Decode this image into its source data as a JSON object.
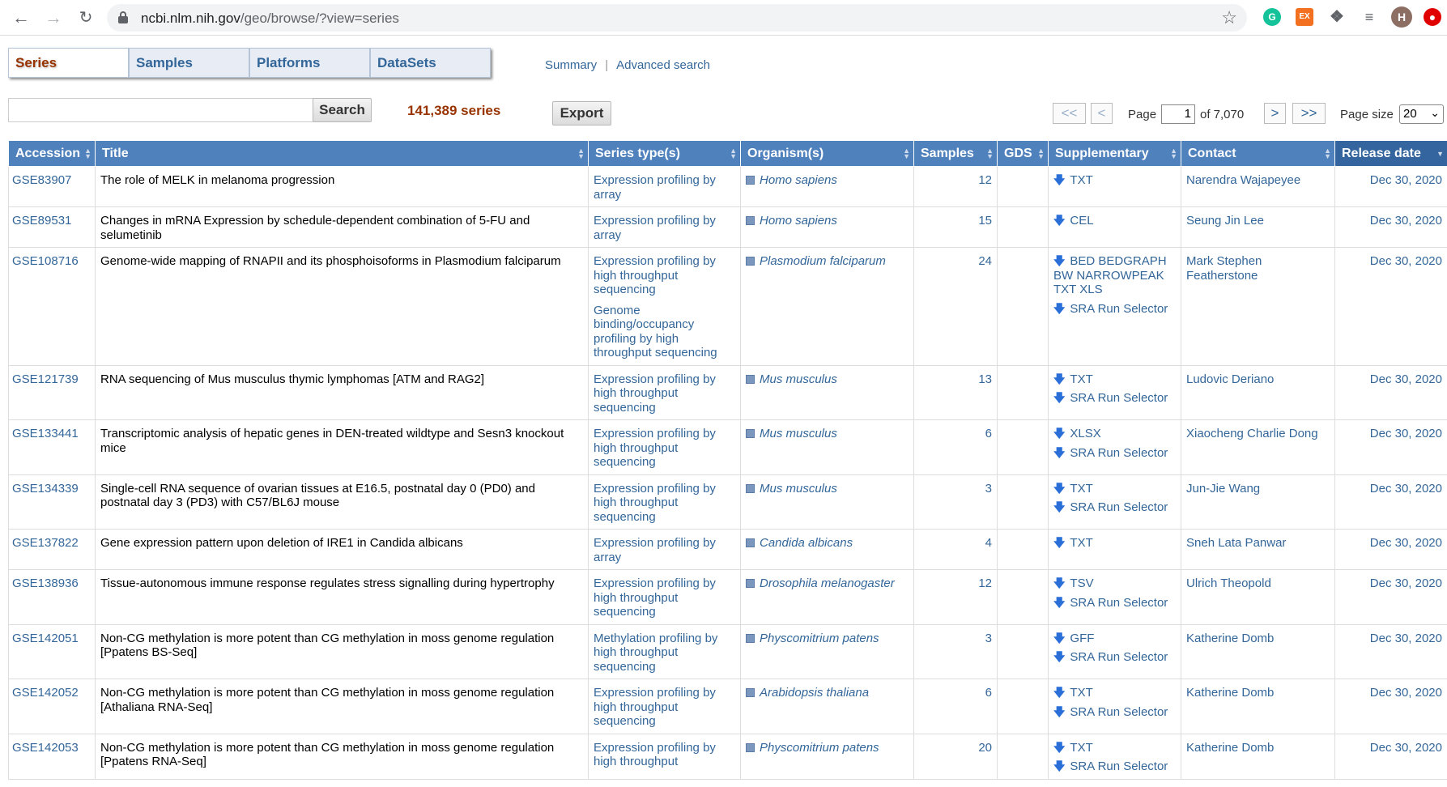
{
  "browser": {
    "url_host": "ncbi.nlm.nih.gov",
    "url_path": "/geo/browse/?view=series",
    "profile_initial": "H",
    "ext_label": "EX"
  },
  "tabs": [
    "Series",
    "Samples",
    "Platforms",
    "DataSets"
  ],
  "links": {
    "summary": "Summary",
    "separator": "|",
    "advanced": "Advanced search"
  },
  "search": {
    "value": "",
    "button": "Search"
  },
  "result_count": "141,389 series",
  "export_label": "Export",
  "pager": {
    "first": "<<",
    "prev": "<",
    "page_label": "Page",
    "page_value": "1",
    "of_label": "of 7,070",
    "next": ">",
    "last": ">>",
    "page_size_label": "Page size",
    "page_size_value": "20"
  },
  "columns": [
    "Accession",
    "Title",
    "Series type(s)",
    "Organism(s)",
    "Samples",
    "GDS",
    "Supplementary",
    "Contact",
    "Release date"
  ],
  "rows": [
    {
      "accession": "GSE83907",
      "title": "The role of MELK in melanoma progression",
      "types": [
        "Expression profiling by array"
      ],
      "organism": "Homo sapiens",
      "samples": "12",
      "gds": "",
      "supp": [
        "TXT"
      ],
      "contact": "Narendra Wajapeyee",
      "date": "Dec 30, 2020"
    },
    {
      "accession": "GSE89531",
      "title": "Changes in mRNA Expression by schedule-dependent combination of 5-FU and selumetinib",
      "types": [
        "Expression profiling by array"
      ],
      "organism": "Homo sapiens",
      "samples": "15",
      "gds": "",
      "supp": [
        "CEL"
      ],
      "contact": "Seung Jin Lee",
      "date": "Dec 30, 2020"
    },
    {
      "accession": "GSE108716",
      "title": "Genome-wide mapping of RNAPII and its phosphoisoforms in Plasmodium falciparum",
      "types": [
        "Expression profiling by high throughput sequencing",
        "Genome binding/occupancy profiling by high throughput sequencing"
      ],
      "organism": "Plasmodium falciparum",
      "samples": "24",
      "gds": "",
      "supp": [
        "BED BEDGRAPH BW NARROWPEAK TXT XLS",
        "SRA Run Selector"
      ],
      "contact": "Mark Stephen Featherstone",
      "date": "Dec 30, 2020"
    },
    {
      "accession": "GSE121739",
      "title": "RNA sequencing of Mus musculus thymic lymphomas [ATM and RAG2]",
      "types": [
        "Expression profiling by high throughput sequencing"
      ],
      "organism": "Mus musculus",
      "samples": "13",
      "gds": "",
      "supp": [
        "TXT",
        "SRA Run Selector"
      ],
      "contact": "Ludovic Deriano",
      "date": "Dec 30, 2020"
    },
    {
      "accession": "GSE133441",
      "title": "Transcriptomic analysis of hepatic genes in DEN-treated wildtype and Sesn3 knockout mice",
      "types": [
        "Expression profiling by high throughput sequencing"
      ],
      "organism": "Mus musculus",
      "samples": "6",
      "gds": "",
      "supp": [
        "XLSX",
        "SRA Run Selector"
      ],
      "contact": "Xiaocheng Charlie Dong",
      "date": "Dec 30, 2020"
    },
    {
      "accession": "GSE134339",
      "title": "Single-cell RNA sequence of ovarian tissues at E16.5, postnatal day 0 (PD0) and postnatal day 3 (PD3) with C57/BL6J mouse",
      "types": [
        "Expression profiling by high throughput sequencing"
      ],
      "organism": "Mus musculus",
      "samples": "3",
      "gds": "",
      "supp": [
        "TXT",
        "SRA Run Selector"
      ],
      "contact": "Jun-Jie Wang",
      "date": "Dec 30, 2020"
    },
    {
      "accession": "GSE137822",
      "title": "Gene expression pattern upon deletion of IRE1 in Candida albicans",
      "types": [
        "Expression profiling by array"
      ],
      "organism": "Candida albicans",
      "samples": "4",
      "gds": "",
      "supp": [
        "TXT"
      ],
      "contact": "Sneh Lata Panwar",
      "date": "Dec 30, 2020"
    },
    {
      "accession": "GSE138936",
      "title": "Tissue-autonomous immune response regulates stress signalling during hypertrophy",
      "types": [
        "Expression profiling by high throughput sequencing"
      ],
      "organism": "Drosophila melanogaster",
      "samples": "12",
      "gds": "",
      "supp": [
        "TSV",
        "SRA Run Selector"
      ],
      "contact": "Ulrich Theopold",
      "date": "Dec 30, 2020"
    },
    {
      "accession": "GSE142051",
      "title": "Non-CG methylation is more potent than CG methylation in moss genome regulation [Ppatens BS-Seq]",
      "types": [
        "Methylation profiling by high throughput sequencing"
      ],
      "organism": "Physcomitrium patens",
      "samples": "3",
      "gds": "",
      "supp": [
        "GFF",
        "SRA Run Selector"
      ],
      "contact": "Katherine Domb",
      "date": "Dec 30, 2020"
    },
    {
      "accession": "GSE142052",
      "title": "Non-CG methylation is more potent than CG methylation in moss genome regulation [Athaliana RNA-Seq]",
      "types": [
        "Expression profiling by high throughput sequencing"
      ],
      "organism": "Arabidopsis thaliana",
      "samples": "6",
      "gds": "",
      "supp": [
        "TXT",
        "SRA Run Selector"
      ],
      "contact": "Katherine Domb",
      "date": "Dec 30, 2020"
    },
    {
      "accession": "GSE142053",
      "title": "Non-CG methylation is more potent than CG methylation in moss genome regulation [Ppatens RNA-Seq]",
      "types": [
        "Expression profiling by high throughput"
      ],
      "organism": "Physcomitrium patens",
      "samples": "20",
      "gds": "",
      "supp": [
        "TXT",
        "SRA Run Selector"
      ],
      "contact": "Katherine Domb",
      "date": "Dec 30, 2020"
    }
  ]
}
